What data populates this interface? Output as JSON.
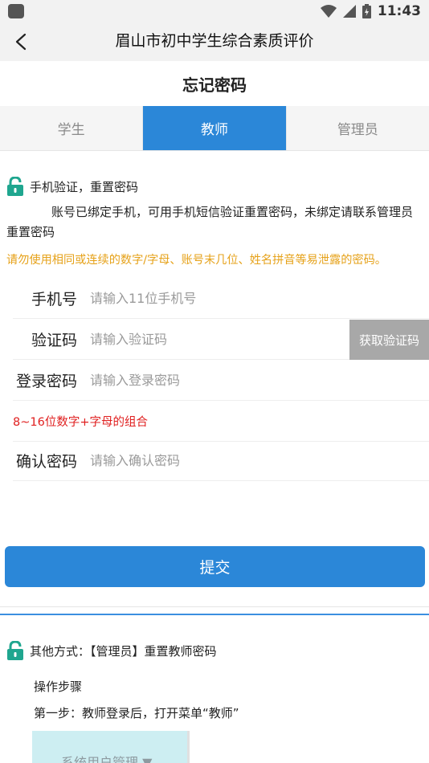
{
  "status_bar": {
    "time": "11:43"
  },
  "nav": {
    "title": "眉山市初中学生综合素质评价"
  },
  "page": {
    "title": "忘记密码"
  },
  "tabs": [
    {
      "label": "学生",
      "active": false
    },
    {
      "label": "教师",
      "active": true
    },
    {
      "label": "管理员",
      "active": false
    }
  ],
  "phone_section": {
    "title": "手机验证，重置密码",
    "description": "账号已绑定手机，可用手机短信验证重置密码，未绑定请联系管理员重置密码",
    "warning": "请勿使用相同或连续的数字/字母、账号末几位、姓名拼音等易泄露的密码。"
  },
  "form": {
    "phone": {
      "label": "手机号",
      "placeholder": "请输入11位手机号"
    },
    "code": {
      "label": "验证码",
      "placeholder": "请输入验证码",
      "button": "获取验证码"
    },
    "password": {
      "label": "登录密码",
      "placeholder": "请输入登录密码"
    },
    "password_hint": "8~16位数字+字母的组合",
    "confirm": {
      "label": "确认密码",
      "placeholder": "请输入确认密码"
    },
    "submit": "提交"
  },
  "other_section": {
    "title": "其他方式：【管理员】重置教师密码",
    "steps_title": "操作步骤",
    "step1": "第一步：教师登录后，打开菜单“教师”",
    "preview_label": "系统用户管理 ▼"
  },
  "colors": {
    "primary": "#2b87d8",
    "warning": "#e6a21a",
    "error": "#e02020",
    "disabled_button": "#a8a8a8",
    "lock": "#1fa68f"
  }
}
